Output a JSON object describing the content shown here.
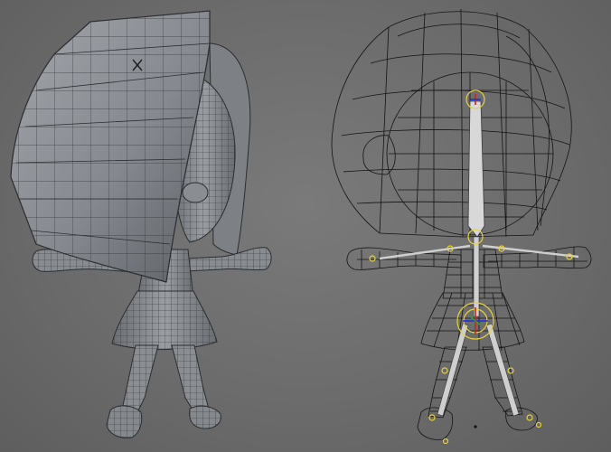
{
  "viewport": {
    "background": "#6e6e6e",
    "models": [
      {
        "name": "solid-shaded-model",
        "shading": "solid",
        "color": "#8a8d92"
      },
      {
        "name": "wireframe-rigged-model",
        "shading": "wireframe",
        "color": "#111111"
      }
    ],
    "rig": {
      "joint_color": "#e8d23a",
      "bone_color": "#d8d8d8"
    },
    "icons": [
      "pivot-cross-icon"
    ]
  }
}
